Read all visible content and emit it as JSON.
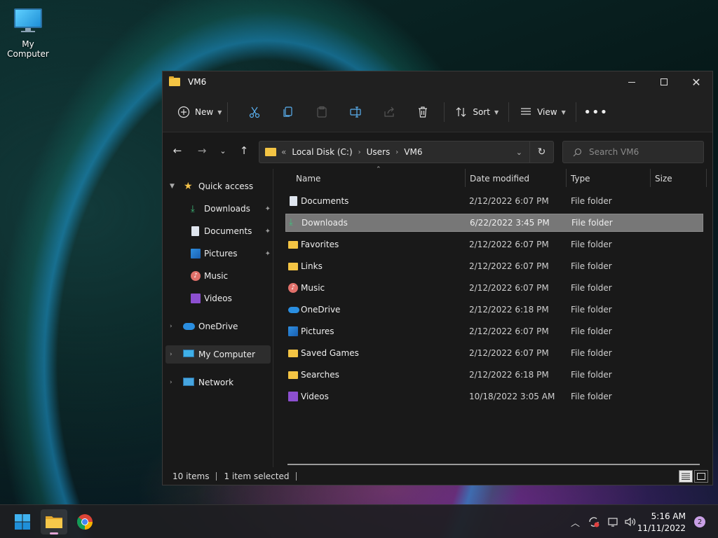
{
  "desktop": {
    "icon_label": "My Computer"
  },
  "window": {
    "title": "VM6",
    "toolbar": {
      "new_label": "New",
      "sort_label": "Sort",
      "view_label": "View"
    },
    "address": {
      "overflow": "«",
      "crumbs": [
        "Local Disk (C:)",
        "Users",
        "VM6"
      ]
    },
    "search": {
      "placeholder": "Search VM6"
    },
    "nav": {
      "quick_access": "Quick access",
      "pinned": [
        "Downloads",
        "Documents",
        "Pictures",
        "Music",
        "Videos"
      ],
      "onedrive": "OneDrive",
      "my_computer": "My Computer",
      "network": "Network"
    },
    "columns": {
      "name": "Name",
      "date": "Date modified",
      "type": "Type",
      "size": "Size"
    },
    "files": [
      {
        "name": "Documents",
        "date": "2/12/2022 6:07 PM",
        "type": "File folder",
        "icon": "documents-icon"
      },
      {
        "name": "Downloads",
        "date": "6/22/2022 3:45 PM",
        "type": "File folder",
        "icon": "downloads-icon"
      },
      {
        "name": "Favorites",
        "date": "2/12/2022 6:07 PM",
        "type": "File folder",
        "icon": "folder-icon"
      },
      {
        "name": "Links",
        "date": "2/12/2022 6:07 PM",
        "type": "File folder",
        "icon": "folder-icon"
      },
      {
        "name": "Music",
        "date": "2/12/2022 6:07 PM",
        "type": "File folder",
        "icon": "music-icon"
      },
      {
        "name": "OneDrive",
        "date": "2/12/2022 6:18 PM",
        "type": "File folder",
        "icon": "onedrive-icon"
      },
      {
        "name": "Pictures",
        "date": "2/12/2022 6:07 PM",
        "type": "File folder",
        "icon": "pictures-icon"
      },
      {
        "name": "Saved Games",
        "date": "2/12/2022 6:07 PM",
        "type": "File folder",
        "icon": "folder-icon"
      },
      {
        "name": "Searches",
        "date": "2/12/2022 6:18 PM",
        "type": "File folder",
        "icon": "folder-icon"
      },
      {
        "name": "Videos",
        "date": "10/18/2022 3:05 AM",
        "type": "File folder",
        "icon": "videos-icon"
      }
    ],
    "status": {
      "count": "10 items",
      "selected": "1 item selected"
    }
  },
  "taskbar": {
    "time": "5:16 AM",
    "date": "11/11/2022",
    "notifications": "2"
  }
}
